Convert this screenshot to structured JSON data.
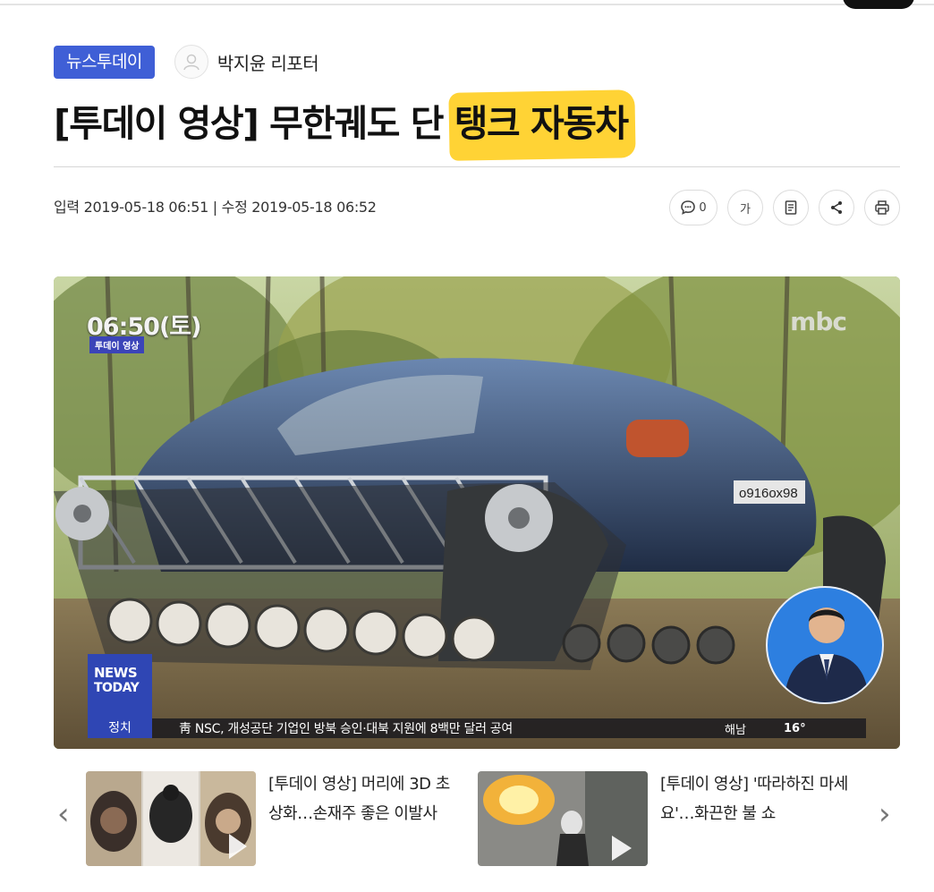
{
  "article": {
    "section_badge": "뉴스투데이",
    "reporter": "박지윤 리포터",
    "title_prefix": "[투데이 영상] 무한궤도 단 ",
    "title_highlight": "탱크 자동차",
    "dates": "입력 2019-05-18 06:51 | 수정 2019-05-18 06:52"
  },
  "toolbar": {
    "comment_count": "0",
    "font_size_label": "가"
  },
  "video": {
    "time": "06:50(토)",
    "tag": "투데이 영상",
    "logo": "mbc",
    "news_line1": "NEWS",
    "news_line2": "TODAY",
    "ticker_category": "정치",
    "ticker_text": "靑 NSC, 개성공단 기업인 방북 승인·대북 지원에 8백만 달러 공여",
    "ticker_weather": "해남",
    "ticker_temp": "16°",
    "plate": "о916ох98"
  },
  "related": [
    {
      "title": "[투데이 영상] 머리에 3D 초상화…손재주 좋은 이발사"
    },
    {
      "title": "[투데이 영상] '따라하진 마세요'…화끈한 불 쇼"
    }
  ],
  "colors": {
    "accent_blue": "#3f5fd6",
    "highlight_yellow": "#ffce1f"
  }
}
